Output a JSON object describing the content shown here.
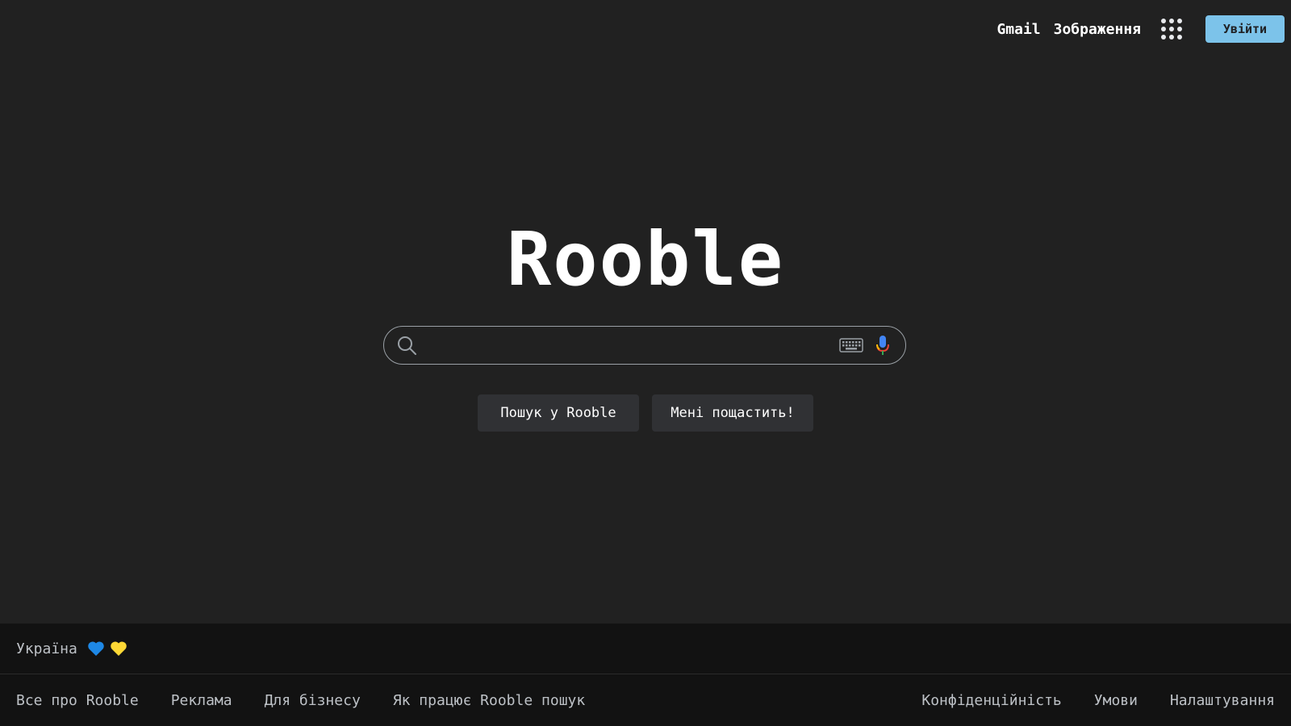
{
  "header": {
    "gmail_label": "Gmail",
    "images_label": "Зображення",
    "apps_icon": "apps-grid-icon",
    "signin_label": "Увійти"
  },
  "logo": {
    "text": "Rooble"
  },
  "search": {
    "value": "",
    "placeholder": "",
    "search_icon": "search-icon",
    "keyboard_icon": "keyboard-icon",
    "mic_icon": "mic-icon"
  },
  "buttons": {
    "search_label": "Пошук у Rooble",
    "lucky_label": "Мені пощастить!"
  },
  "footer": {
    "country": "Україна",
    "hearts": [
      "blue-heart-icon",
      "yellow-heart-icon"
    ],
    "left_links": [
      "Все про Rooble",
      "Реклама",
      "Для бізнесу",
      "Як працює Rooble пошук"
    ],
    "right_links": [
      "Конфіденційність",
      "Умови",
      "Налаштування"
    ]
  },
  "colors": {
    "background": "#212121",
    "footer_background": "#121212",
    "signin_button": "#7cc3ea",
    "button_background": "#303134",
    "blue_heart": "#1e88e5",
    "yellow_heart": "#fdd835"
  }
}
